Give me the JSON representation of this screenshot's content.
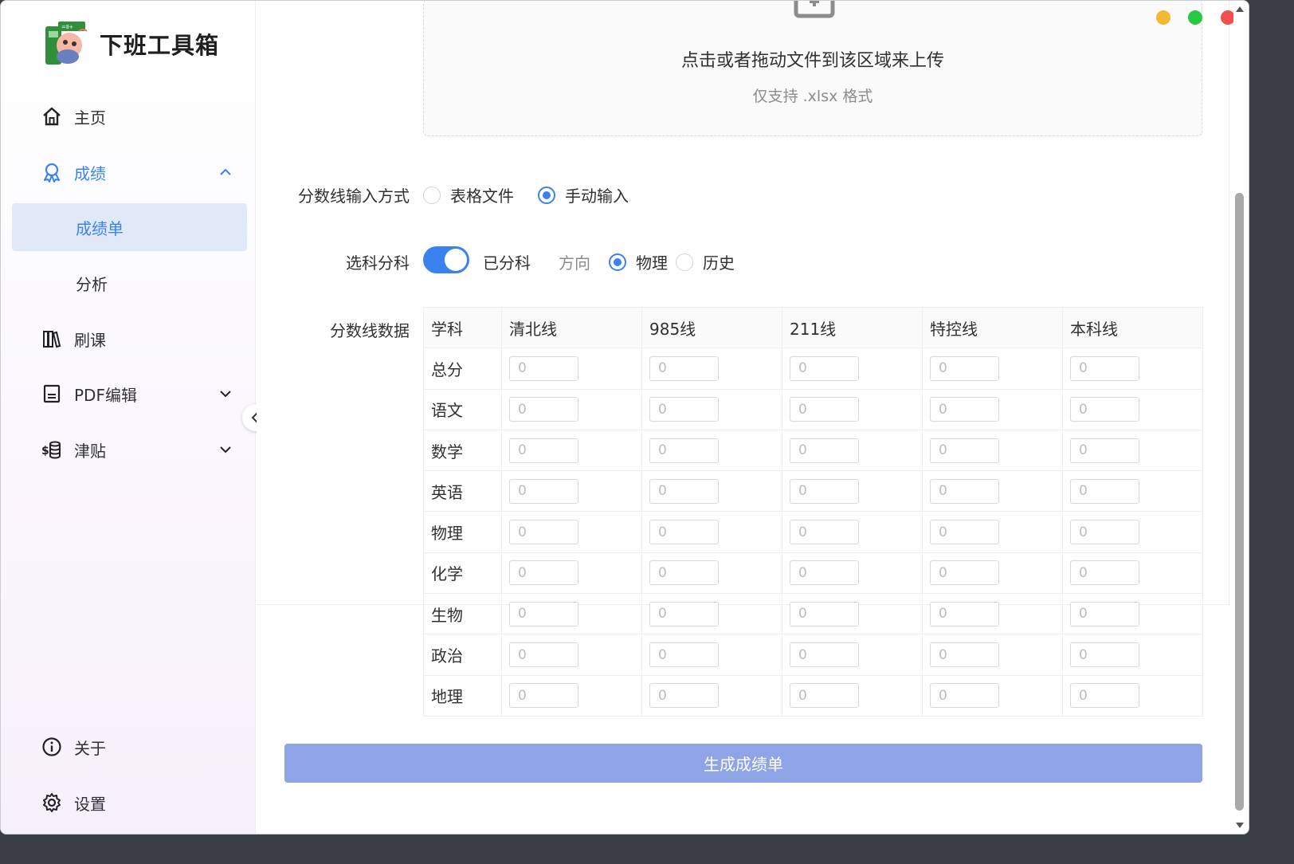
{
  "app": {
    "title": "下班工具箱"
  },
  "sidebar": {
    "items": [
      {
        "label": "主页",
        "icon": "home-icon"
      },
      {
        "label": "成绩",
        "icon": "award-icon",
        "expanded": true,
        "children": [
          {
            "label": "成绩单",
            "selected": true
          },
          {
            "label": "分析"
          }
        ]
      },
      {
        "label": "刷课",
        "icon": "books-icon"
      },
      {
        "label": "PDF编辑",
        "icon": "document-icon",
        "expandable": true
      },
      {
        "label": "津贴",
        "icon": "money-icon",
        "expandable": true
      }
    ],
    "footer": [
      {
        "label": "关于",
        "icon": "info-icon"
      },
      {
        "label": "设置",
        "icon": "gear-icon"
      }
    ]
  },
  "upload": {
    "title": "点击或者拖动文件到该区域来上传",
    "hint": "仅支持 .xlsx 格式"
  },
  "form": {
    "input_mode": {
      "label": "分数线输入方式",
      "options": [
        {
          "label": "表格文件",
          "checked": false
        },
        {
          "label": "手动输入",
          "checked": true
        }
      ]
    },
    "subject_split": {
      "label": "选科分科",
      "switch_on": true,
      "switch_text": "已分科",
      "direction_label": "方向",
      "options": [
        {
          "label": "物理",
          "checked": true
        },
        {
          "label": "历史",
          "checked": false
        }
      ]
    },
    "score_data": {
      "label": "分数线数据",
      "columns": [
        "学科",
        "清北线",
        "985线",
        "211线",
        "特控线",
        "本科线"
      ],
      "rows": [
        "总分",
        "语文",
        "数学",
        "英语",
        "物理",
        "化学",
        "生物",
        "政治",
        "地理"
      ],
      "placeholder": "0"
    }
  },
  "generate_button": "生成成绩单",
  "colors": {
    "accent": "#3a82f0",
    "button": "#8ea4e6",
    "traffic_yellow": "#f5b833",
    "traffic_green": "#28c840",
    "traffic_red": "#f0514f"
  }
}
